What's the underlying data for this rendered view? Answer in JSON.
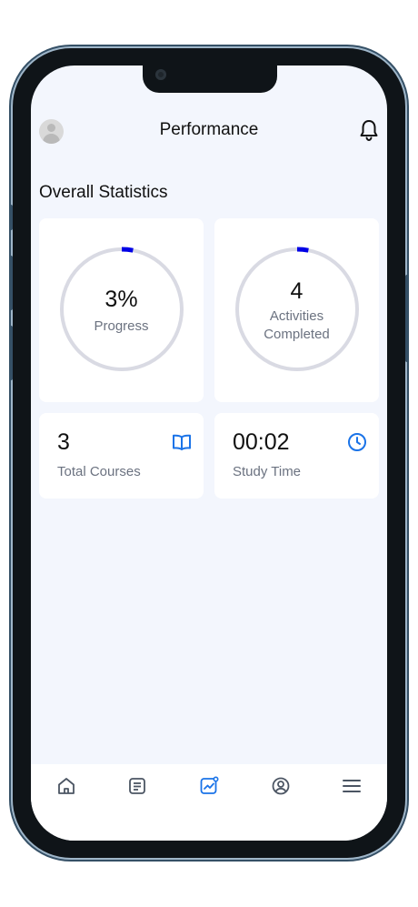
{
  "header": {
    "title": "Performance",
    "avatar_icon": "user-avatar-icon",
    "bell_icon": "bell-icon"
  },
  "section_title": "Overall Statistics",
  "progress_card": {
    "value": "3%",
    "label": "Progress",
    "fraction": 0.03,
    "ring_color": "#0000e6",
    "track_color": "#d9dae3"
  },
  "activities_card": {
    "value": "4",
    "label_line1": "Activities",
    "label_line2": "Completed",
    "fraction": 0.03,
    "ring_color": "#0000e6",
    "track_color": "#d9dae3"
  },
  "courses_card": {
    "value": "3",
    "label": "Total Courses",
    "icon": "book-icon",
    "icon_color": "#1a73e8"
  },
  "study_card": {
    "value": "00:02",
    "label": "Study Time",
    "icon": "clock-icon",
    "icon_color": "#1a73e8"
  },
  "tabbar": {
    "items": [
      {
        "icon": "home-icon",
        "active": false
      },
      {
        "icon": "document-icon",
        "active": false
      },
      {
        "icon": "chart-icon",
        "active": true
      },
      {
        "icon": "user-icon",
        "active": false
      },
      {
        "icon": "menu-icon",
        "active": false
      }
    ],
    "active_color": "#1a73e8",
    "inactive_color": "#4b5563"
  }
}
